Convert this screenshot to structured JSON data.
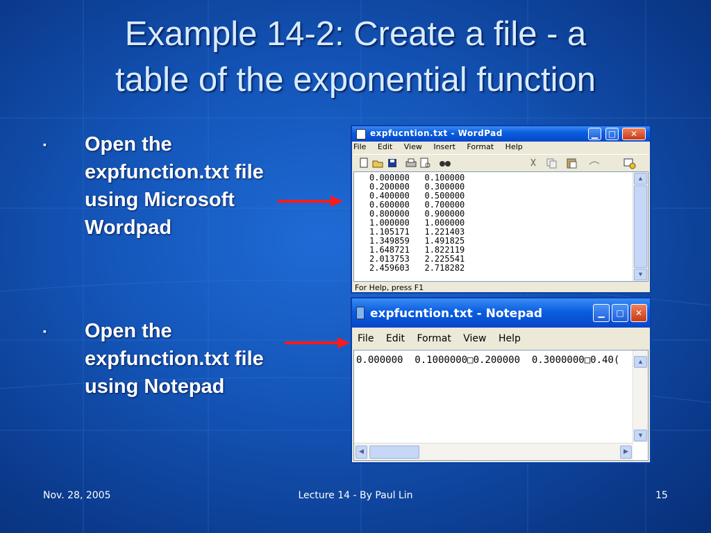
{
  "slide": {
    "title_line1": "Example 14-2: Create a file - a",
    "title_line2": "table of the exponential function",
    "bullets": [
      {
        "mark": "▪",
        "lines": [
          "Open the",
          "expfunction.txt file",
          "using Microsoft",
          "Wordpad"
        ]
      },
      {
        "mark": "▪",
        "lines": [
          "Open the",
          "expfunction.txt file",
          "using Notepad"
        ]
      }
    ],
    "footer_left": "Nov. 28, 2005",
    "footer_center": "Lecture 14 - By Paul Lin",
    "footer_right": "15",
    "arrow_color": "#ff1a1a"
  },
  "wordpad": {
    "title": "expfucntion.txt - WordPad",
    "menu": [
      "File",
      "Edit",
      "View",
      "Insert",
      "Format",
      "Help"
    ],
    "toolbar_icons": [
      "new-icon",
      "open-icon",
      "save-icon",
      "print-icon",
      "print-preview-icon",
      "find-icon",
      "cut-icon",
      "copy-icon",
      "paste-icon",
      "undo-icon",
      "date-time-icon"
    ],
    "rows": [
      [
        "0.000000",
        "0.100000"
      ],
      [
        "0.200000",
        "0.300000"
      ],
      [
        "0.400000",
        "0.500000"
      ],
      [
        "0.600000",
        "0.700000"
      ],
      [
        "0.800000",
        "0.900000"
      ],
      [
        "1.000000",
        "1.000000"
      ],
      [
        "1.105171",
        "1.221403"
      ],
      [
        "1.349859",
        "1.491825"
      ],
      [
        "1.648721",
        "1.822119"
      ],
      [
        "2.013753",
        "2.225541"
      ],
      [
        "2.459603",
        "2.718282"
      ]
    ],
    "status": "For Help, press F1"
  },
  "notepad": {
    "title": "expfucntion.txt - Notepad",
    "menu": [
      "File",
      "Edit",
      "Format",
      "View",
      "Help"
    ],
    "line": "0.000000  0.1000000□0.200000  0.3000000□0.40("
  }
}
